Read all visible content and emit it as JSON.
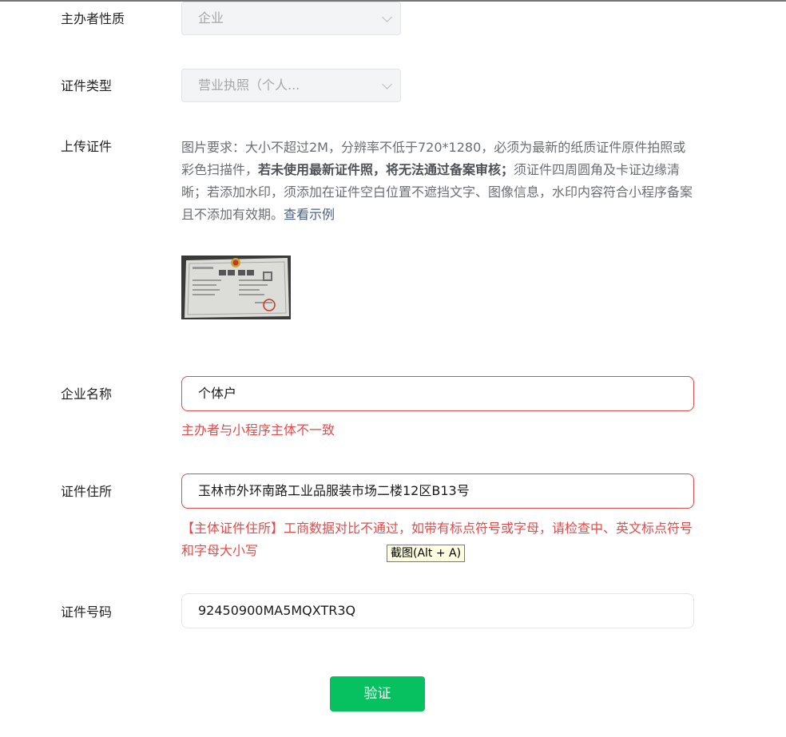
{
  "form": {
    "organizer_type": {
      "label": "主办者性质",
      "value": "企业"
    },
    "cert_type": {
      "label": "证件类型",
      "value": "营业执照（个人..."
    },
    "upload": {
      "label": "上传证件",
      "desc_part1": "图片要求：大小不超过2M，分辨率不低于720*1280，必须为最新的纸质证件原件拍照或彩色扫描件，",
      "desc_bold": "若未使用最新证件照，将无法通过备案审核；",
      "desc_part2": "须证件四周圆角及卡证边缘清晰；若添加水印，须添加在证件空白位置不遮挡文字、图像信息，水印内容符合小程序备案且不添加有效期。",
      "example_link": "查看示例",
      "thumb_title": "营业执照"
    },
    "company_name": {
      "label": "企业名称",
      "value": "个体户",
      "error": "主办者与小程序主体不一致"
    },
    "cert_address": {
      "label": "证件住所",
      "value": "玉林市外环南路工业品服装市场二楼12区B13号",
      "error": "【主体证件住所】工商数据对比不通过，如带有标点符号或字母，请检查中、英文标点符号和字母大小写"
    },
    "cert_number": {
      "label": "证件号码",
      "value": "92450900MA5MQXTR3Q"
    },
    "verify_button": "验证"
  },
  "tooltip": "截图(Alt + A)",
  "colors": {
    "primary_green": "#07c160",
    "error_red": "#e24b4b",
    "link_blue": "#4c5f86"
  }
}
